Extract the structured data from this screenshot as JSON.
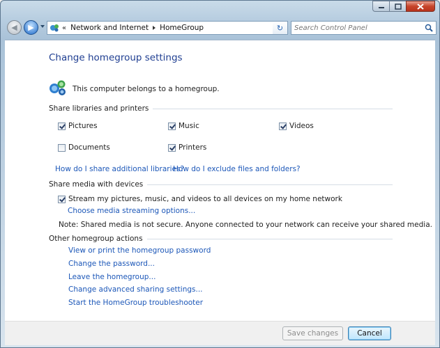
{
  "address_bar": {
    "overflow_chevron": "«",
    "breadcrumbs": [
      "Network and Internet",
      "HomeGroup"
    ]
  },
  "search": {
    "placeholder": "Search Control Panel"
  },
  "page": {
    "title": "Change homegroup settings",
    "status": "This computer belongs to a homegroup."
  },
  "share_libraries": {
    "heading": "Share libraries and printers",
    "items": [
      {
        "label": "Pictures",
        "checked": true
      },
      {
        "label": "Music",
        "checked": true
      },
      {
        "label": "Videos",
        "checked": true
      },
      {
        "label": "Documents",
        "checked": false
      },
      {
        "label": "Printers",
        "checked": true
      }
    ],
    "link_share": "How do I share additional libraries?",
    "link_exclude": "How do I exclude files and folders?"
  },
  "share_media": {
    "heading": "Share media with devices",
    "stream_label": "Stream my pictures, music, and videos to all devices on my home network",
    "stream_checked": true,
    "options_link": "Choose media streaming options...",
    "note": "Note: Shared media is not secure. Anyone connected to your network can receive your shared media."
  },
  "other_actions": {
    "heading": "Other homegroup actions",
    "links": [
      "View or print the homegroup password",
      "Change the password...",
      "Leave the homegroup...",
      "Change advanced sharing settings...",
      "Start the HomeGroup troubleshooter"
    ]
  },
  "footer": {
    "save_label": "Save changes",
    "cancel_label": "Cancel"
  },
  "colors": {
    "link": "#1c57b8",
    "title": "#1f3e91",
    "accent": "#3c7fb1"
  }
}
